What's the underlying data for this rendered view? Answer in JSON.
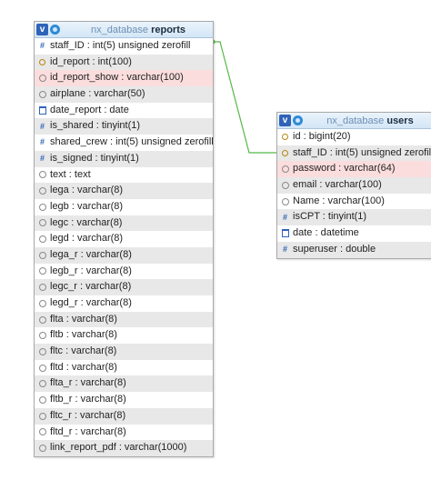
{
  "reports_table": {
    "v_label": "v",
    "db": "nx_database",
    "name": "reports",
    "fields": [
      {
        "label": "staff_ID : int(5) unsigned zerofill",
        "icon": "hash-icon",
        "style": "plain"
      },
      {
        "label": "id_report : int(100)",
        "icon": "key-icon",
        "style": "alt"
      },
      {
        "label": "id_report_show : varchar(100)",
        "icon": "text-icon",
        "style": "highlight"
      },
      {
        "label": "airplane : varchar(50)",
        "icon": "text-icon",
        "style": "alt"
      },
      {
        "label": "date_report : date",
        "icon": "date-icon",
        "style": "plain"
      },
      {
        "label": "is_shared : tinyint(1)",
        "icon": "hash-icon",
        "style": "alt"
      },
      {
        "label": "shared_crew : int(5) unsigned zerofill",
        "icon": "hash-icon",
        "style": "plain"
      },
      {
        "label": "is_signed : tinyint(1)",
        "icon": "hash-icon",
        "style": "alt"
      },
      {
        "label": "text : text",
        "icon": "text-icon",
        "style": "plain"
      },
      {
        "label": "lega : varchar(8)",
        "icon": "text-icon",
        "style": "alt"
      },
      {
        "label": "legb : varchar(8)",
        "icon": "text-icon",
        "style": "plain"
      },
      {
        "label": "legc : varchar(8)",
        "icon": "text-icon",
        "style": "alt"
      },
      {
        "label": "legd : varchar(8)",
        "icon": "text-icon",
        "style": "plain"
      },
      {
        "label": "lega_r : varchar(8)",
        "icon": "text-icon",
        "style": "alt"
      },
      {
        "label": "legb_r : varchar(8)",
        "icon": "text-icon",
        "style": "plain"
      },
      {
        "label": "legc_r : varchar(8)",
        "icon": "text-icon",
        "style": "alt"
      },
      {
        "label": "legd_r : varchar(8)",
        "icon": "text-icon",
        "style": "plain"
      },
      {
        "label": "flta : varchar(8)",
        "icon": "text-icon",
        "style": "alt"
      },
      {
        "label": "fltb : varchar(8)",
        "icon": "text-icon",
        "style": "plain"
      },
      {
        "label": "fltc : varchar(8)",
        "icon": "text-icon",
        "style": "alt"
      },
      {
        "label": "fltd : varchar(8)",
        "icon": "text-icon",
        "style": "plain"
      },
      {
        "label": "flta_r : varchar(8)",
        "icon": "text-icon",
        "style": "alt"
      },
      {
        "label": "fltb_r : varchar(8)",
        "icon": "text-icon",
        "style": "plain"
      },
      {
        "label": "fltc_r : varchar(8)",
        "icon": "text-icon",
        "style": "alt"
      },
      {
        "label": "fltd_r : varchar(8)",
        "icon": "text-icon",
        "style": "plain"
      },
      {
        "label": "link_report_pdf : varchar(1000)",
        "icon": "text-icon",
        "style": "alt"
      }
    ]
  },
  "users_table": {
    "v_label": "v",
    "db": "nx_database",
    "name": "users",
    "fields": [
      {
        "label": "id : bigint(20)",
        "icon": "key-icon",
        "style": "plain"
      },
      {
        "label": "staff_ID : int(5) unsigned zerofill",
        "icon": "key-icon",
        "style": "alt"
      },
      {
        "label": "password : varchar(64)",
        "icon": "text-icon",
        "style": "highlight"
      },
      {
        "label": "email : varchar(100)",
        "icon": "text-icon",
        "style": "alt"
      },
      {
        "label": "Name : varchar(100)",
        "icon": "text-icon",
        "style": "plain"
      },
      {
        "label": "isCPT : tinyint(1)",
        "icon": "hash-icon",
        "style": "alt"
      },
      {
        "label": "date : datetime",
        "icon": "date-icon",
        "style": "plain"
      },
      {
        "label": "superuser : double",
        "icon": "hash-icon",
        "style": "alt"
      }
    ]
  },
  "colors": {
    "relation_line": "#55b947",
    "header_title": "#1b2d3f",
    "header_db": "#6d8fb5",
    "row_alt": "#e8e8e8",
    "row_highlight": "#fbdddd"
  }
}
